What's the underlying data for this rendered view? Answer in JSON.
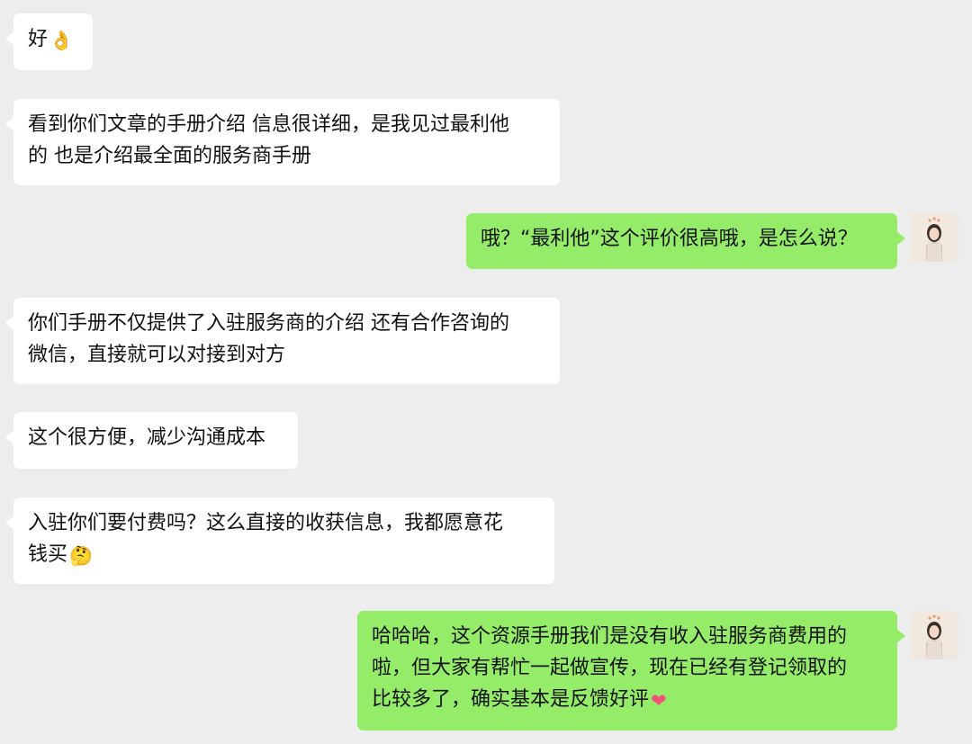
{
  "messages": [
    {
      "side": "in",
      "lines": [
        "好"
      ],
      "emoji": "ok-hand",
      "emoji_glyph": "👌"
    },
    {
      "side": "in",
      "lines": [
        "看到你们文章的手册介绍 信息很详细，是我见过最利他",
        "的 也是介绍最全面的服务商手册"
      ]
    },
    {
      "side": "out",
      "lines": [
        "哦？“最利他”这个评价很高哦，是怎么说？"
      ]
    },
    {
      "side": "in",
      "lines": [
        "你们手册不仅提供了入驻服务商的介绍 还有合作咨询的",
        "微信，直接就可以对接到对方"
      ]
    },
    {
      "side": "in",
      "lines": [
        "这个很方便，减少沟通成本"
      ]
    },
    {
      "side": "in",
      "lines": [
        "入驻你们要付费吗？这么直接的收获信息，我都愿意花",
        "钱买"
      ],
      "emoji": "thinking-face",
      "emoji_glyph": "🤔"
    },
    {
      "side": "out",
      "lines": [
        "哈哈哈，这个资源手册我们是没有收入驻服务商费用的",
        "啦，但大家有帮忙一起做宣传，现在已经有登记领取的",
        "比较多了，确实基本是反馈好评"
      ],
      "emoji": "heart",
      "emoji_glyph": "❤"
    }
  ],
  "colors": {
    "background": "#ededed",
    "incoming_bubble": "#ffffff",
    "outgoing_bubble": "#95ec69",
    "text": "#111111"
  }
}
